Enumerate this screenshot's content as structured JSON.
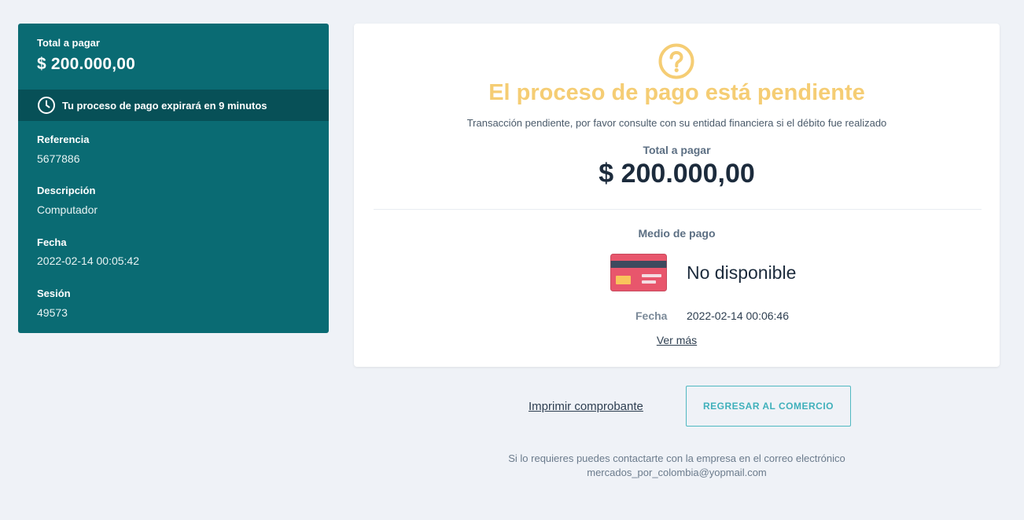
{
  "sidebar": {
    "total_label": "Total a pagar",
    "total_amount": "$ 200.000,00",
    "timer_text": "Tu proceso de pago expirará en 9 minutos",
    "fields": [
      {
        "label": "Referencia",
        "value": "5677886"
      },
      {
        "label": "Descripción",
        "value": "Computador"
      },
      {
        "label": "Fecha",
        "value": "2022-02-14 00:05:42"
      },
      {
        "label": "Sesión",
        "value": "49573"
      }
    ]
  },
  "status": {
    "icon": "question-circle-icon",
    "title": "El proceso de pago está pendiente",
    "subtitle": "Transacción pendiente, por favor consulte con su entidad financiera si el débito fue realizado",
    "color": "#f5cd74"
  },
  "payment": {
    "total_label": "Total a pagar",
    "total_amount": "$ 200.000,00",
    "method_label": "Medio de pago",
    "method_icon": "credit-card-icon",
    "method_value": "No disponible",
    "date_label": "Fecha",
    "date_value": "2022-02-14 00:06:46",
    "more_link": "Ver más"
  },
  "actions": {
    "print_label": "Imprimir comprobante",
    "return_label": "REGRESAR AL COMERCIO"
  },
  "contact": {
    "line1": "Si lo requieres puedes contactarte con la empresa en el correo electrónico",
    "email": "mercados_por_colombia@yopmail.com"
  },
  "colors": {
    "sidebar_bg": "#0a6b73",
    "timer_bg": "#075057",
    "accent": "#3fb0bb",
    "pending": "#f5cd74"
  }
}
